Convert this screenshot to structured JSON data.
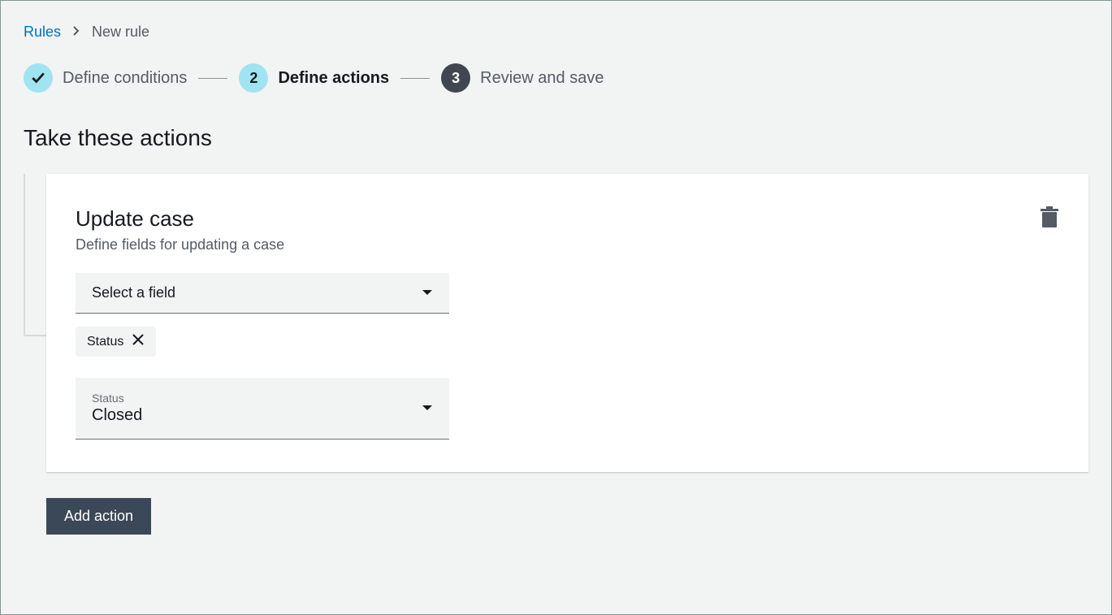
{
  "breadcrumb": {
    "root": "Rules",
    "current": "New rule"
  },
  "stepper": {
    "step1": {
      "label": "Define conditions"
    },
    "step2": {
      "num": "2",
      "label": "Define actions"
    },
    "step3": {
      "num": "3",
      "label": "Review and save"
    }
  },
  "page_title": "Take these actions",
  "action_card": {
    "title": "Update case",
    "subtitle": "Define fields for updating a case",
    "field_select_placeholder": "Select a field",
    "tag_label": "Status",
    "status_field": {
      "label": "Status",
      "value": "Closed"
    }
  },
  "add_action_label": "Add action"
}
